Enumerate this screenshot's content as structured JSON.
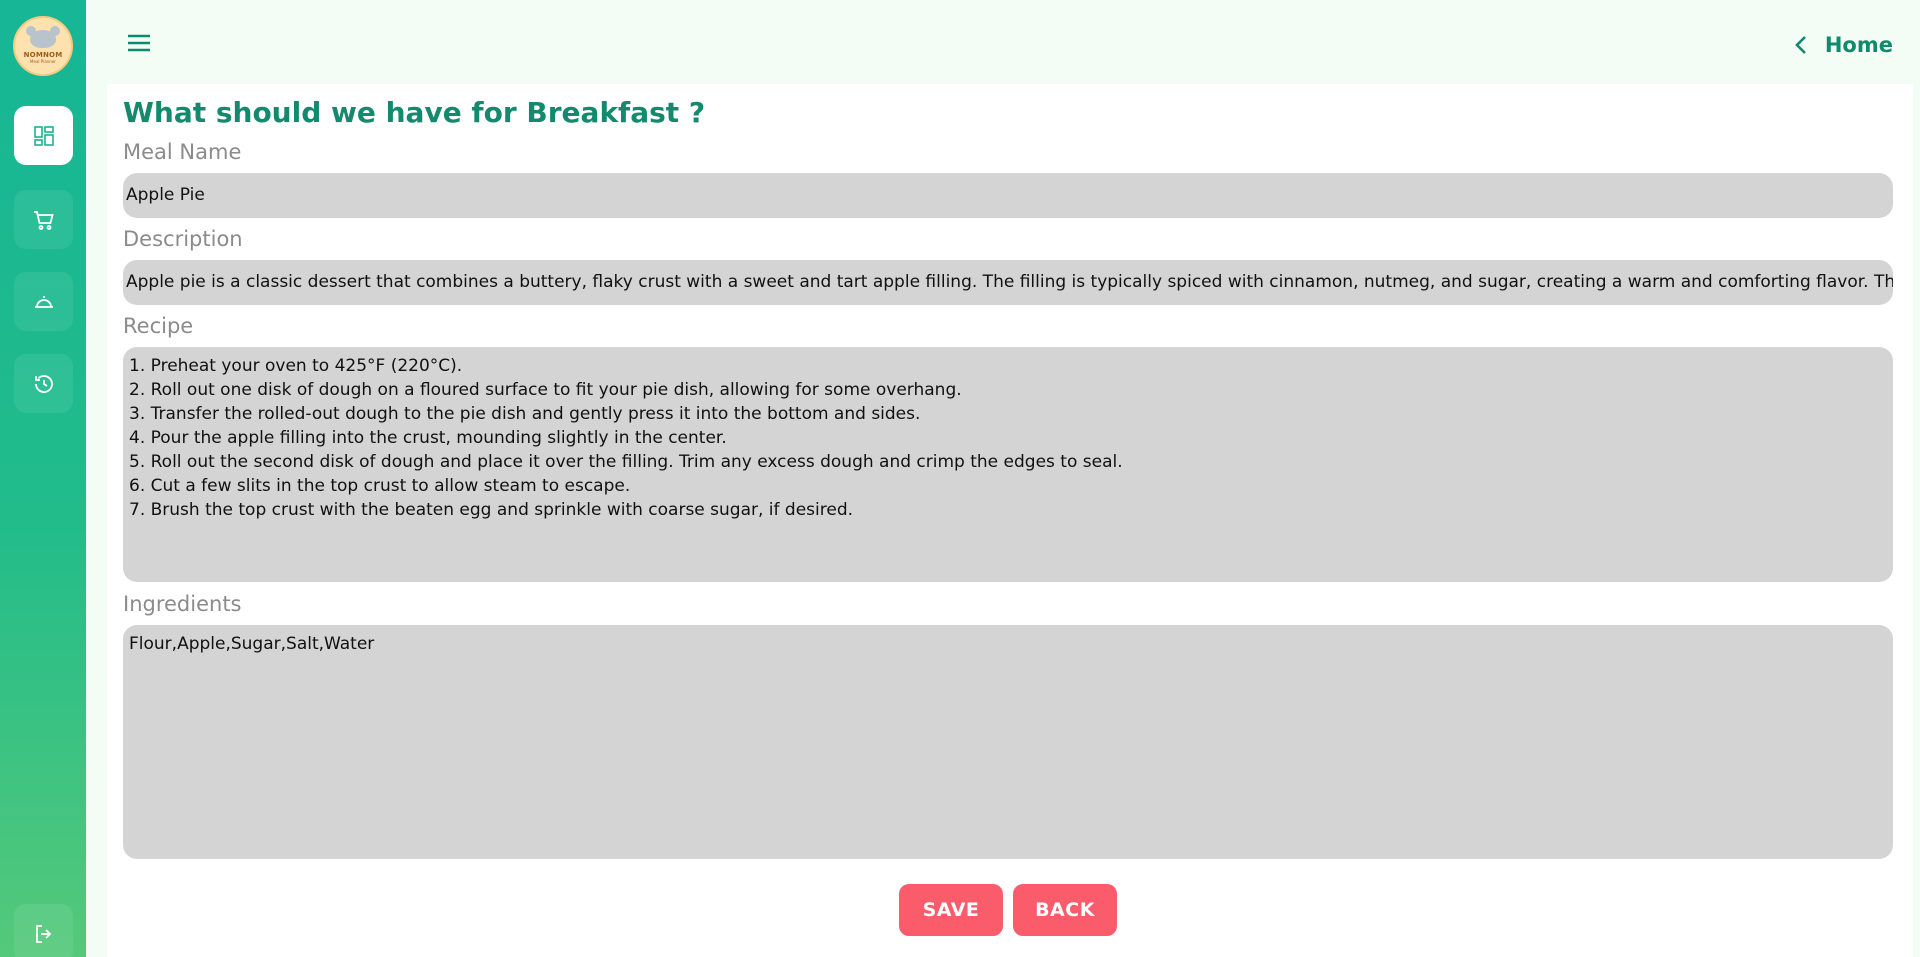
{
  "brand": {
    "logo_text": "NOMNOM",
    "logo_sub": "Meal Planner"
  },
  "sidebar": {
    "items": [
      {
        "icon": "dashboard-icon",
        "active": true
      },
      {
        "icon": "cart-icon",
        "active": false
      },
      {
        "icon": "cloche-icon",
        "active": false
      },
      {
        "icon": "history-icon",
        "active": false
      }
    ],
    "logout_icon": "logout-icon"
  },
  "topbar": {
    "menu_icon": "hamburger-menu-icon",
    "home_label": "Home"
  },
  "form": {
    "title": "What should we have for Breakfast ?",
    "meal_name_label": "Meal Name",
    "meal_name_value": "Apple Pie",
    "description_label": "Description",
    "description_value": "Apple pie is a classic dessert that combines a buttery, flaky crust with a sweet and tart apple filling. The filling is typically spiced with cinnamon, nutmeg, and sugar, creating a warm and comforting flavor. This pie is perfect for",
    "recipe_label": "Recipe",
    "recipe_value": "1. Preheat your oven to 425°F (220°C).\n2. Roll out one disk of dough on a floured surface to fit your pie dish, allowing for some overhang.\n3. Transfer the rolled-out dough to the pie dish and gently press it into the bottom and sides.\n4. Pour the apple filling into the crust, mounding slightly in the center.\n5. Roll out the second disk of dough and place it over the filling. Trim any excess dough and crimp the edges to seal.\n6. Cut a few slits in the top crust to allow steam to escape.\n7. Brush the top crust with the beaten egg and sprinkle with coarse sugar, if desired.",
    "ingredients_label": "Ingredients",
    "ingredients_value": "Flour,Apple,Sugar,Salt,Water"
  },
  "actions": {
    "save_label": "SAVE",
    "back_label": "BACK"
  },
  "colors": {
    "accent": "#138a6d",
    "button": "#fb5c6c",
    "field_bg": "#d4d4d4"
  }
}
